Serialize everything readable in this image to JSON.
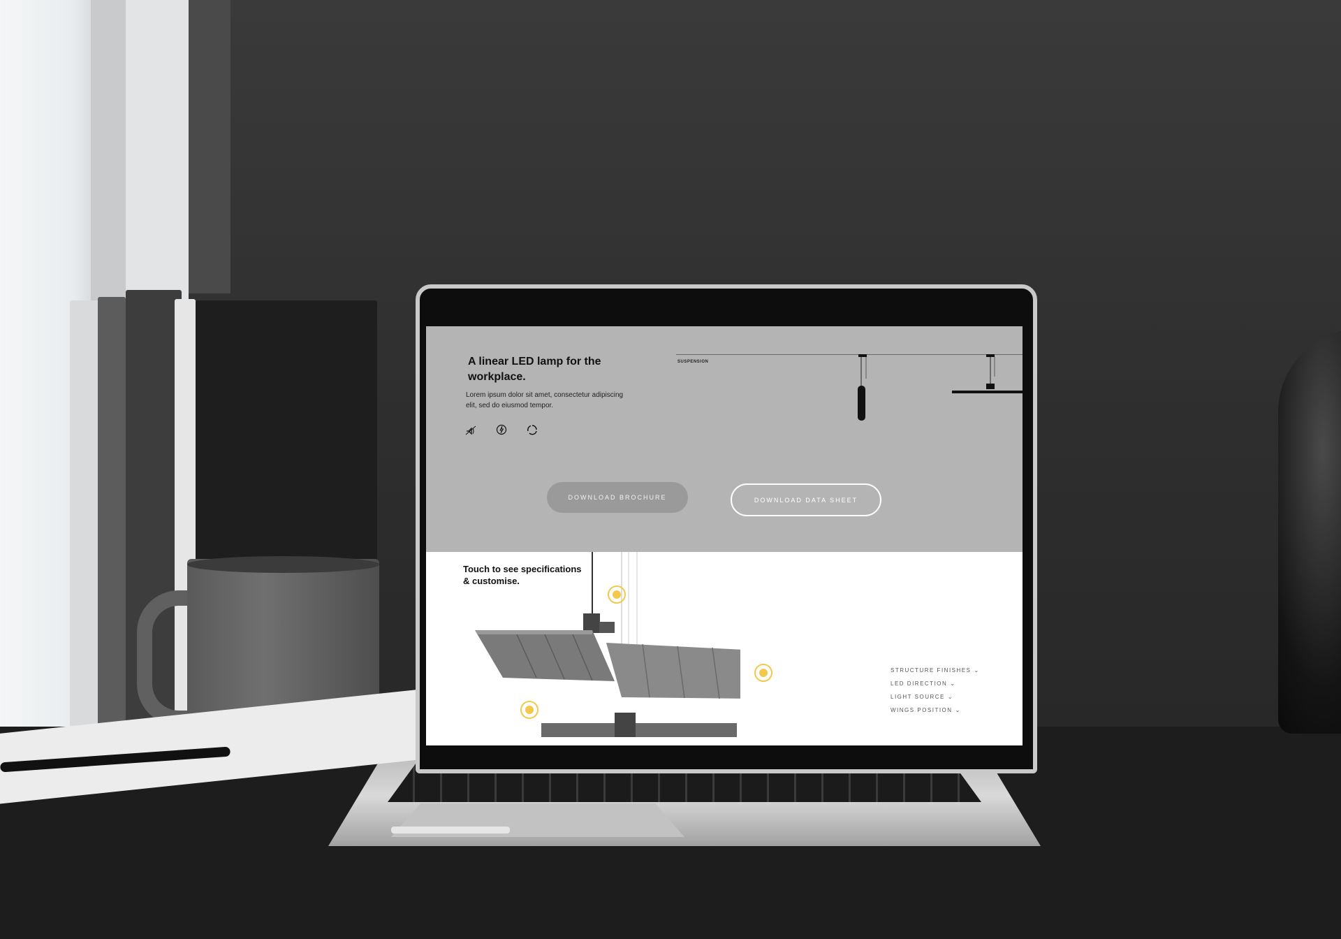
{
  "hero": {
    "headline": "A linear LED lamp for the workplace.",
    "lede": "Lorem ipsum dolor sit amet, consectetur adipiscing elit, sed do eiusmod tempor.",
    "icons": [
      "no-flicker-icon",
      "energy-icon",
      "recycle-icon"
    ],
    "drawing_label": "SUSPENSION"
  },
  "buttons": {
    "brochure_label": "DOWNLOAD BROCHURE",
    "datasheet_label": "DOWNLOAD DATA SHEET"
  },
  "configurator": {
    "title": "Touch to see specifications & customise.",
    "options": [
      {
        "label": "STRUCTURE FINISHES"
      },
      {
        "label": "LED DIRECTION"
      },
      {
        "label": "LIGHT SOURCE"
      },
      {
        "label": "WINGS POSITION"
      }
    ],
    "chevron": "⌄",
    "hotspot_color": "#f2c94c"
  },
  "colors": {
    "hero_bg": "#b4b4b4",
    "brochure_button_bg": "#9a9a9a"
  }
}
